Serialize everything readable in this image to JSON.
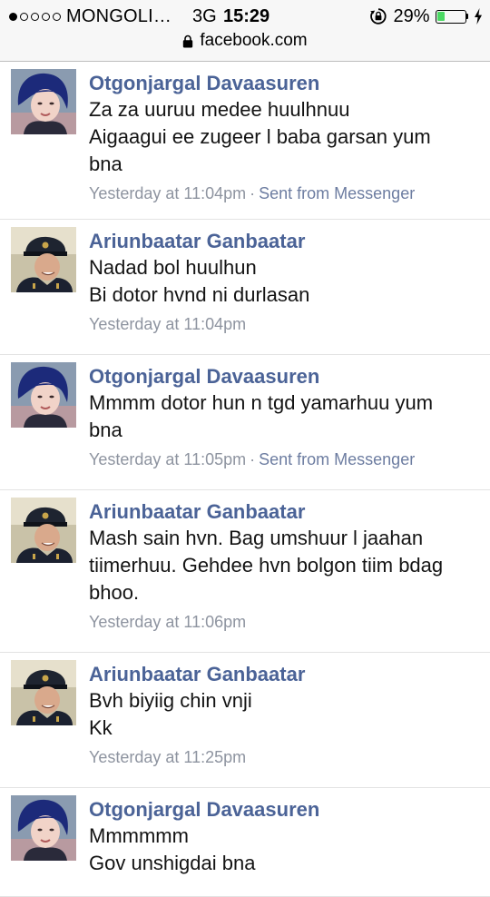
{
  "status_bar": {
    "signal_bars_filled": 1,
    "signal_bars_total": 5,
    "carrier": "MONGOLI…",
    "network": "3G",
    "time": "15:29",
    "battery": "29%",
    "battery_level": 0.29,
    "battery_color": "#4cd964"
  },
  "url_bar": {
    "url": "facebook.com"
  },
  "colors": {
    "author": "#4b6397",
    "meta": "#8e94a0",
    "divider": "#e3e3e3"
  },
  "messages": [
    {
      "author": "Otgonjargal Davaasuren",
      "avatar": "female-avatar",
      "lines": [
        "Za za uuruu medee huulhnuu",
        "Aigaagui ee zugeer l baba garsan yum",
        "bna"
      ],
      "timestamp": "Yesterday at 11:04pm",
      "separator": "·",
      "via": "Sent from Messenger"
    },
    {
      "author": "Ariunbaatar Ganbaatar",
      "avatar": "male-avatar",
      "lines": [
        "Nadad bol huulhun",
        "Bi dotor hvnd ni durlasan"
      ],
      "timestamp": "Yesterday at 11:04pm"
    },
    {
      "author": "Otgonjargal Davaasuren",
      "avatar": "female-avatar",
      "lines": [
        "Mmmm dotor hun n tgd yamarhuu yum",
        "bna"
      ],
      "timestamp": "Yesterday at 11:05pm",
      "separator": "·",
      "via": "Sent from Messenger"
    },
    {
      "author": "Ariunbaatar Ganbaatar",
      "avatar": "male-avatar",
      "lines": [
        "Mash sain hvn. Bag umshuur l jaahan",
        "tiimerhuu. Gehdee hvn bolgon tiim bdag",
        "bhoo."
      ],
      "timestamp": "Yesterday at 11:06pm"
    },
    {
      "author": "Ariunbaatar Ganbaatar",
      "avatar": "male-avatar",
      "lines": [
        "Bvh biyiig chin vnji",
        "Kk"
      ],
      "timestamp": "Yesterday at 11:25pm"
    },
    {
      "author": "Otgonjargal Davaasuren",
      "avatar": "female-avatar",
      "lines": [
        "Mmmmmm",
        "Gov unshigdai bna"
      ],
      "timestamp": ""
    }
  ]
}
